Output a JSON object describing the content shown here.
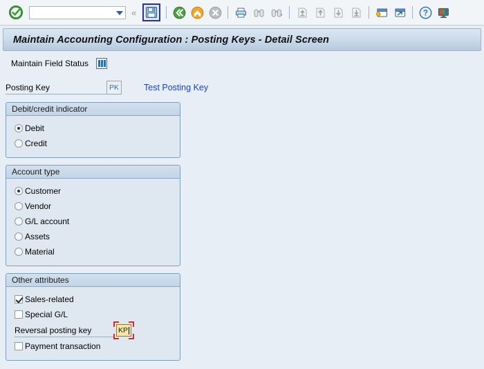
{
  "toolbar": {
    "ok_icon": "green-check-icon",
    "command_field": {
      "value": "",
      "placeholder": ""
    },
    "dropdown_icon": "chevron-down-icon",
    "collapse_icon": "double-chevron-left-icon",
    "buttons": [
      {
        "name": "save-button",
        "icon": "save-floppy-icon",
        "focused": true
      },
      {
        "name": "back-button",
        "icon": "back-green-arrow-icon",
        "focused": false
      },
      {
        "name": "exit-button",
        "icon": "exit-orange-arrow-icon",
        "focused": false
      },
      {
        "name": "cancel-button",
        "icon": "cancel-x-icon",
        "focused": false
      },
      {
        "name": "print-button",
        "icon": "printer-icon",
        "focused": false
      },
      {
        "name": "find-button",
        "icon": "binoculars-icon",
        "focused": false
      },
      {
        "name": "find-next-button",
        "icon": "binoculars-plus-icon",
        "focused": false
      },
      {
        "name": "first-page-button",
        "icon": "page-first-icon",
        "focused": false
      },
      {
        "name": "previous-page-button",
        "icon": "page-up-icon",
        "focused": false
      },
      {
        "name": "next-page-button",
        "icon": "page-down-icon",
        "focused": false
      },
      {
        "name": "last-page-button",
        "icon": "page-last-icon",
        "focused": false
      },
      {
        "name": "new-session-button",
        "icon": "new-window-icon",
        "focused": false
      },
      {
        "name": "create-shortcut-button",
        "icon": "shortcut-window-icon",
        "focused": false
      },
      {
        "name": "help-button",
        "icon": "help-question-icon",
        "focused": false
      },
      {
        "name": "customize-button",
        "icon": "monitor-layout-icon",
        "focused": false
      }
    ]
  },
  "header": {
    "title": "Maintain Accounting Configuration : Posting Keys - Detail Screen"
  },
  "subtoolbar": {
    "field_status_label": "Maintain Field Status",
    "field_status_icon": "table-columns-icon"
  },
  "posting_key": {
    "label": "Posting Key",
    "value": "",
    "button_label": "PK",
    "test_link": "Test Posting Key"
  },
  "groups": [
    {
      "name": "debit-credit-indicator",
      "title": "Debit/credit indicator",
      "control": "radio",
      "options": [
        {
          "label": "Debit",
          "selected": true
        },
        {
          "label": "Credit",
          "selected": false
        }
      ]
    },
    {
      "name": "account-type",
      "title": "Account type",
      "control": "radio",
      "options": [
        {
          "label": "Customer",
          "selected": true
        },
        {
          "label": "Vendor",
          "selected": false
        },
        {
          "label": "G/L account",
          "selected": false
        },
        {
          "label": "Assets",
          "selected": false
        },
        {
          "label": "Material",
          "selected": false
        }
      ]
    }
  ],
  "other_attributes": {
    "name": "other-attributes",
    "title": "Other attributes",
    "sales_related": {
      "label": "Sales-related",
      "checked": true
    },
    "special_gl": {
      "label": "Special G/L",
      "checked": false
    },
    "reversal_posting_key": {
      "label": "Reversal posting key",
      "value": "KP"
    },
    "payment_transaction": {
      "label": "Payment transaction",
      "checked": false
    }
  },
  "colors": {
    "page_background": "#e8eef5",
    "title_bar": "#c3d5e7",
    "group_border": "#7f9dbd",
    "link": "#1a3fd0",
    "focus_field": "#f6e7a8",
    "focus_marker": "#d42b2b",
    "toolbar_focus": "#2b2bb5"
  }
}
